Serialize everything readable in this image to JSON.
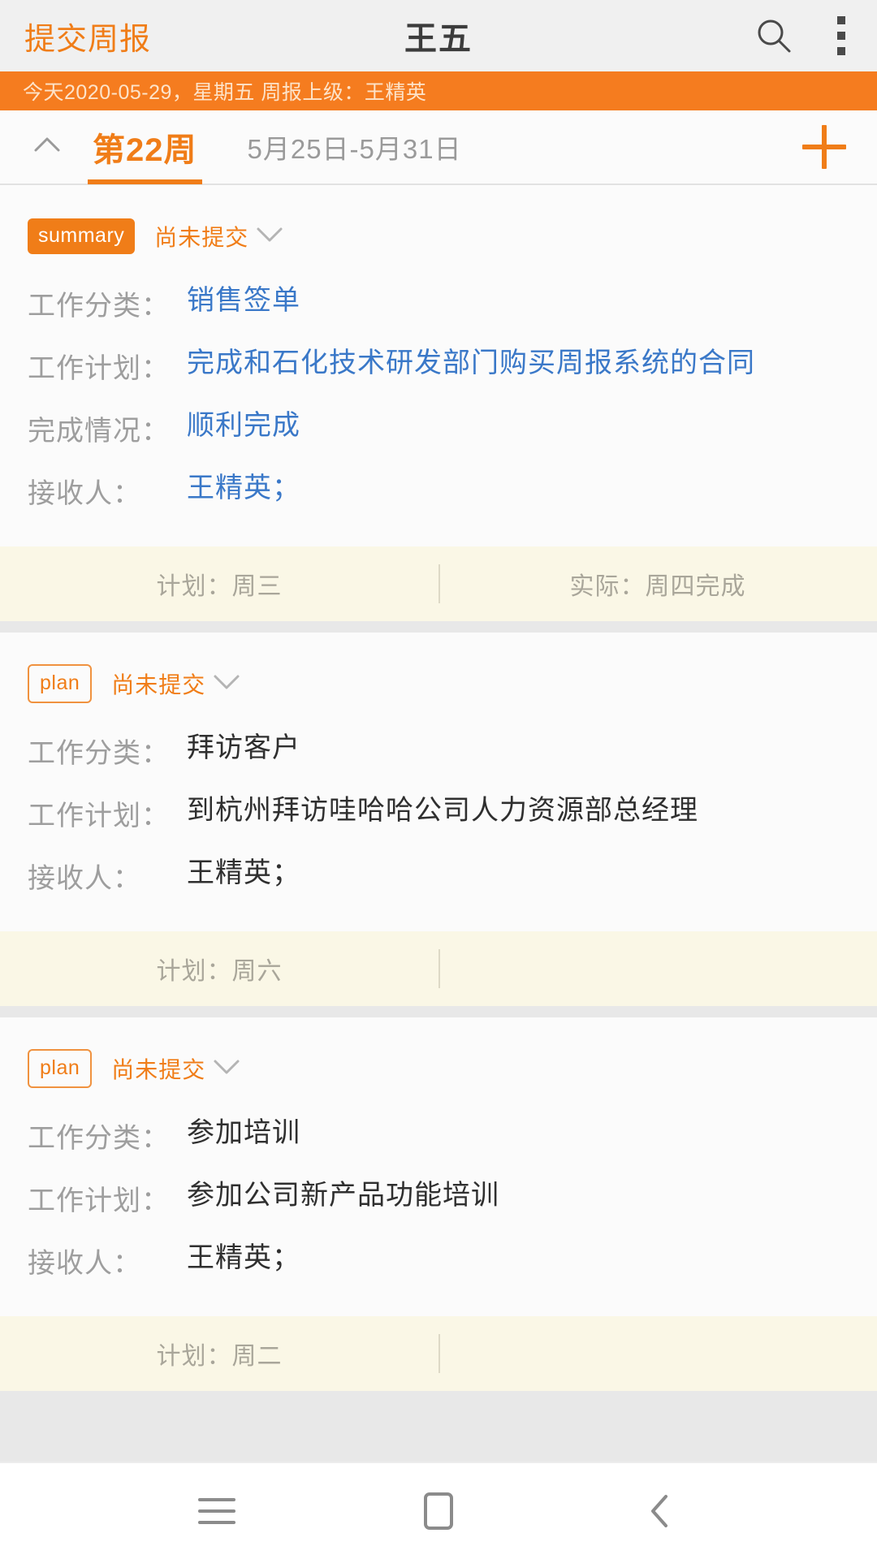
{
  "appbar": {
    "left_action": "提交周报",
    "title": "王五",
    "search_icon": "search-icon",
    "more_icon": "more-vertical-icon"
  },
  "banner": {
    "text": "今天2020-05-29，星期五  周报上级：王精英"
  },
  "weekbar": {
    "collapse_icon": "chevron-up-icon",
    "week_label": "第22周",
    "date_range": "5月25日-5月31日",
    "add_icon": "plus-icon"
  },
  "labels": {
    "category": "工作分类：",
    "plan": "工作计划：",
    "completion": "完成情况：",
    "receiver": "接收人："
  },
  "cards": [
    {
      "badge": "summary",
      "badge_style": "filled",
      "status": "尚未提交",
      "expand_icon": "chevron-down-icon",
      "category": "销售签单",
      "plan": "完成和石化技术研发部门购买周报系统的合同",
      "completion": "顺利完成",
      "receiver": "王精英；",
      "value_color": "blue",
      "foot_planned": "计划：周三",
      "foot_actual": "实际：周四完成"
    },
    {
      "badge": "plan",
      "badge_style": "outline",
      "status": "尚未提交",
      "expand_icon": "chevron-down-icon",
      "category": "拜访客户",
      "plan": "到杭州拜访哇哈哈公司人力资源部总经理",
      "completion": "",
      "receiver": "王精英；",
      "value_color": "dark",
      "foot_planned": "计划：周六",
      "foot_actual": ""
    },
    {
      "badge": "plan",
      "badge_style": "outline",
      "status": "尚未提交",
      "expand_icon": "chevron-down-icon",
      "category": "参加培训",
      "plan": "参加公司新产品功能培训",
      "completion": "",
      "receiver": "王精英；",
      "value_color": "dark",
      "foot_planned": "计划：周二",
      "foot_actual": ""
    }
  ],
  "navbar": {
    "menu_icon": "menu-icon",
    "home_icon": "home-square-icon",
    "back_icon": "back-chevron-icon"
  },
  "colors": {
    "accent": "#f07d18",
    "banner_bg": "#f57c1f",
    "value_blue": "#3a78c8",
    "footer_bg": "#faf7e6"
  }
}
